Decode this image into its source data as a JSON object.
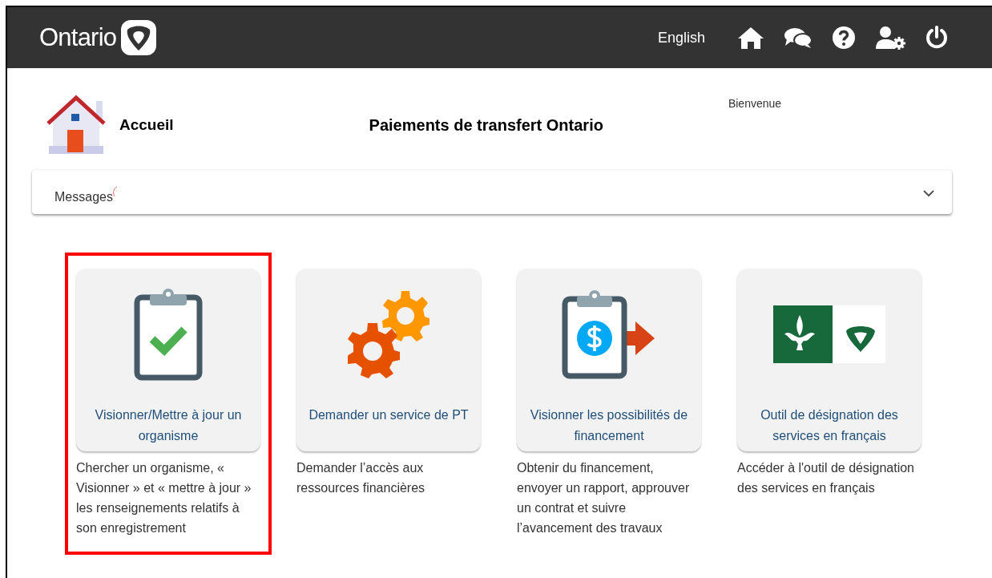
{
  "header": {
    "logo": "Ontario",
    "language_link": "English"
  },
  "page": {
    "home_label": "Accueil",
    "title": "Paiements de transfert Ontario",
    "welcome": "Bienvenue"
  },
  "messages": {
    "label": "Messages",
    "expanded": false
  },
  "cards": [
    {
      "kind": "checklist",
      "title": "Visionner/Mettre à jour un organisme",
      "description": "Chercher un organisme, « Visionner » et « mettre à jour » les renseignements relatifs à son enregistrement",
      "highlighted": true
    },
    {
      "kind": "gears",
      "title": "Demander un service de PT",
      "description": "Demander l’accès aux ressources financières",
      "highlighted": false
    },
    {
      "kind": "funding",
      "title": "Visionner les possibilités de financement",
      "description": "Obtenir du financement, envoyer un rapport, approuver un contrat et suivre l’avancement des travaux",
      "highlighted": false
    },
    {
      "kind": "flag",
      "title": "Outil de désignation des services en français",
      "description": "Accéder à l'outil de désignation des services en français",
      "highlighted": false
    }
  ]
}
